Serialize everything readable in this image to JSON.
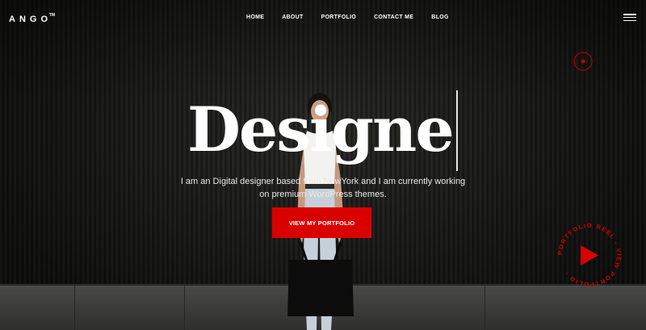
{
  "brand": {
    "logo": "ANGO",
    "trademark": "TM"
  },
  "nav": {
    "items": [
      {
        "label": "HOME"
      },
      {
        "label": "ABOUT"
      },
      {
        "label": "PORTFOLIO"
      },
      {
        "label": "CONTACT ME"
      },
      {
        "label": "BLOG"
      }
    ]
  },
  "hero": {
    "headline": "Designer",
    "subtext_line1": "I am an Digital designer based from NewYork and I am currently working",
    "subtext_line2": "on premium WordPress themes.",
    "cta_label": "VIEW MY PORTFOLIO"
  },
  "reel": {
    "ring_text": "PORTFOLIO REEL - VIEW PORTFOLIO - "
  },
  "colors": {
    "accent": "#d90000",
    "text": "#ffffff",
    "background": "#1a1a19"
  },
  "icons": [
    "menu-icon",
    "target-icon",
    "play-icon"
  ]
}
